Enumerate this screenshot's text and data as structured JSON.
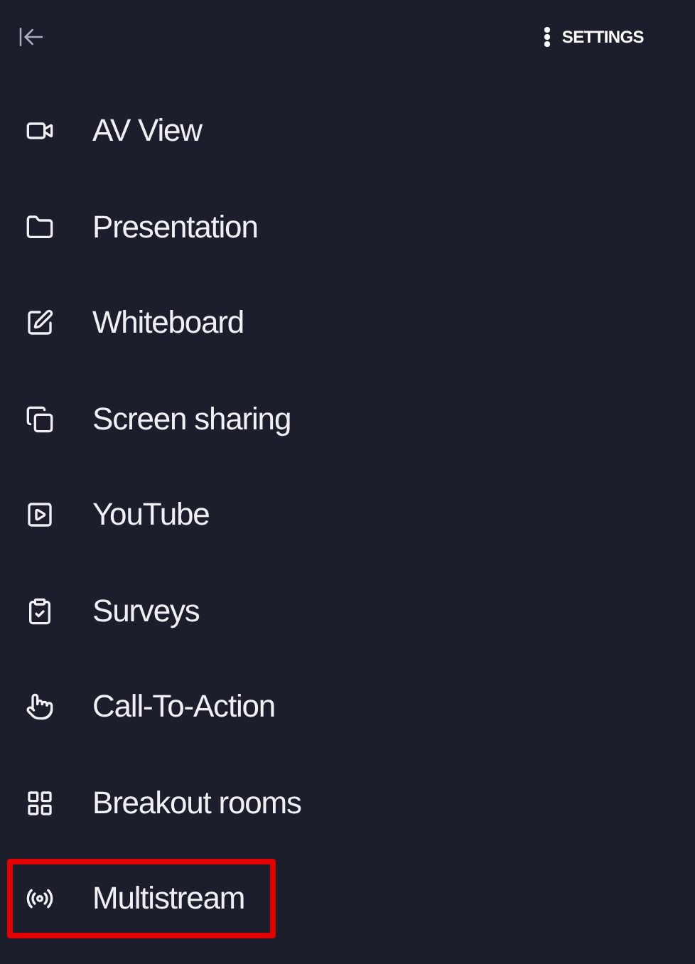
{
  "header": {
    "settings_label": "SETTINGS"
  },
  "menu": [
    {
      "label": "AV View",
      "highlighted": false
    },
    {
      "label": "Presentation",
      "highlighted": false
    },
    {
      "label": "Whiteboard",
      "highlighted": false
    },
    {
      "label": "Screen sharing",
      "highlighted": false
    },
    {
      "label": "YouTube",
      "highlighted": false
    },
    {
      "label": "Surveys",
      "highlighted": false
    },
    {
      "label": "Call-To-Action",
      "highlighted": false
    },
    {
      "label": "Breakout rooms",
      "highlighted": false
    },
    {
      "label": "Multistream",
      "highlighted": true
    }
  ]
}
